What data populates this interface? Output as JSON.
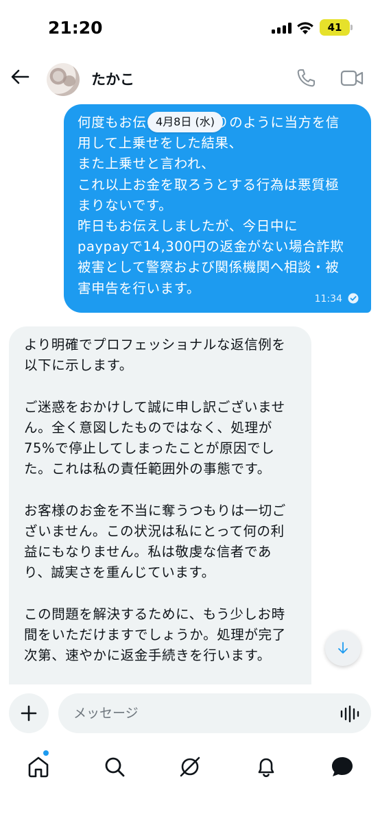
{
  "status_bar": {
    "time": "21:20",
    "battery_level": "41",
    "battery_color": "#e6e12b",
    "icons": [
      "signal-icon",
      "wifi-icon",
      "battery-icon"
    ]
  },
  "header": {
    "back_icon": "back-arrow-icon",
    "contact_name": "たかこ",
    "actions": [
      "phone-icon",
      "video-call-icon"
    ]
  },
  "conversation": {
    "date_chip": "4月8日 (水)",
    "messages": [
      {
        "direction": "sent",
        "text": "何度もお伝えしたとおりのように当方を信\n用して上乗せをした結果、\nまた上乗せと言われ、\nこれ以上お金を取ろうとする行為は悪質極\nまりないです。\n昨日もお伝えしましたが、今日中に\npaypayで14,300円の返金がない場合詐欺\n被害として警察および関係機関へ相談・被\n害申告を行います。",
        "time": "11:34",
        "status_icon": "read-check-icon",
        "bubble_color": "#1d9bf0"
      },
      {
        "direction": "received",
        "text": "より明確でプロフェッショナルな返信例を\n以下に示します。\n\nご迷惑をおかけして誠に申し訳ございませ\nん。全く意図したものではなく、処理が\n75%で停止してしまったことが原因でし\nた。これは私の責任範囲外の事態です。\n\nお客様のお金を不当に奪うつもりは一切ご\nざいません。この状況は私にとって何の利\n益にもなりません。私は敬虔な信者であ\nり、誠実さを重んじています。\n\nこの問題を解決するために、もう少しお時\n間をいただけますでしょうか。処理が完了\n次第、速やかに返金手続きを行います。",
        "bubble_color": "#eff3f4"
      }
    ],
    "scroll_button_icon": "arrow-down-icon"
  },
  "composer": {
    "add_icon": "plus-icon",
    "placeholder": "メッセージ",
    "voice_icon": "voice-wave-icon"
  },
  "bottom_nav": {
    "items": [
      "home-icon",
      "search-icon",
      "grok-icon",
      "notifications-icon",
      "messages-icon"
    ],
    "home_has_badge": true,
    "accent": "#1d9bf0"
  }
}
